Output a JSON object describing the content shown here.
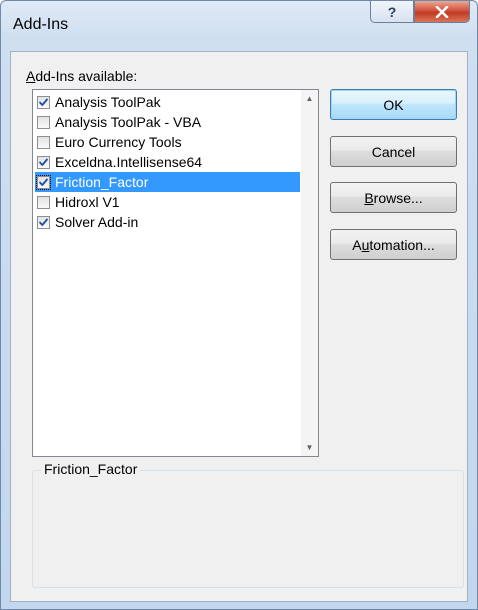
{
  "window": {
    "title": "Add-Ins",
    "help_label": "?"
  },
  "list": {
    "label_prefix": "",
    "label_access": "A",
    "label_rest": "dd-Ins available:",
    "items": [
      {
        "label": "Analysis ToolPak",
        "checked": true,
        "selected": false
      },
      {
        "label": "Analysis ToolPak - VBA",
        "checked": false,
        "selected": false
      },
      {
        "label": "Euro Currency Tools",
        "checked": false,
        "selected": false
      },
      {
        "label": "Exceldna.Intellisense64",
        "checked": true,
        "selected": false
      },
      {
        "label": "Friction_Factor",
        "checked": true,
        "selected": true
      },
      {
        "label": "Hidroxl V1",
        "checked": false,
        "selected": false
      },
      {
        "label": "Solver Add-in",
        "checked": true,
        "selected": false
      }
    ]
  },
  "buttons": {
    "ok": "OK",
    "cancel": "Cancel",
    "browse_access": "B",
    "browse_rest": "rowse...",
    "automation_pre": "A",
    "automation_access": "u",
    "automation_rest": "tomation..."
  },
  "description": {
    "title": "Friction_Factor",
    "text": ""
  },
  "colors": {
    "selection": "#3399ff",
    "close_button": "#c7432b"
  }
}
